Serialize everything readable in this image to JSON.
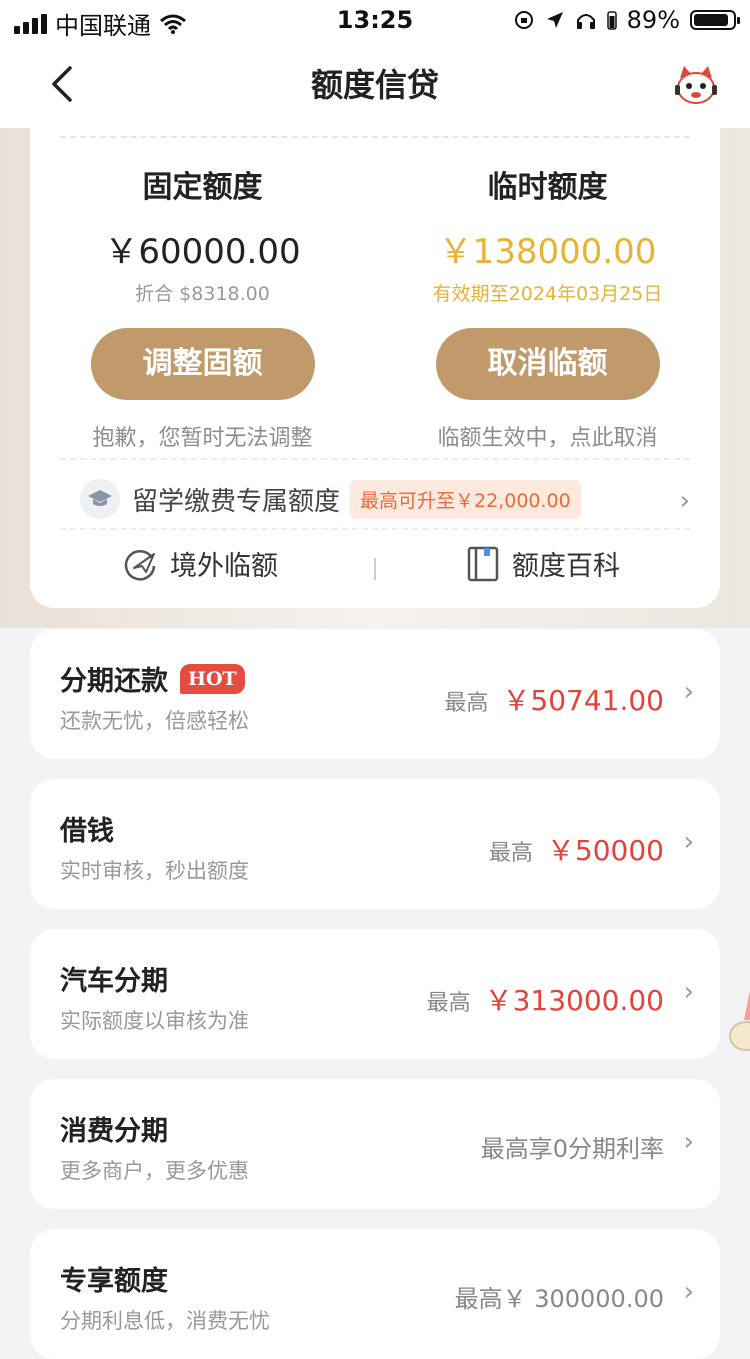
{
  "status_bar": {
    "carrier": "中国联通",
    "time": "13:25",
    "battery_percent": "89%",
    "battery_level": 0.89
  },
  "nav": {
    "title": "额度信贷"
  },
  "quota": {
    "fixed": {
      "title": "固定额度",
      "amount": "￥60000.00",
      "sub": "折合 $8318.00",
      "button": "调整固额",
      "note": "抱歉，您暂时无法调整"
    },
    "temporary": {
      "title": "临时额度",
      "amount": "￥138000.00",
      "sub": "有效期至2024年03月25日",
      "button": "取消临额",
      "note": "临额生效中，点此取消"
    },
    "study": {
      "label": "留学缴费专属额度",
      "badge": "最高可升至￥22,000.00"
    },
    "links": {
      "overseas": "境外临额",
      "wiki": "额度百科"
    }
  },
  "products": [
    {
      "title": "分期还款",
      "hot": "HOT",
      "sub": "还款无忧，倍感轻松",
      "prefix": "最高",
      "amount": "￥50741.00"
    },
    {
      "title": "借钱",
      "sub": "实时审核，秒出额度",
      "prefix": "最高",
      "amount": "￥50000"
    },
    {
      "title": "汽车分期",
      "sub": "实际额度以审核为准",
      "prefix": "最高",
      "amount": "￥313000.00"
    },
    {
      "title": "消费分期",
      "sub": "更多商户，更多优惠",
      "text": "最高享0分期利率"
    },
    {
      "title": "专享额度",
      "sub": "分期利息低，消费无忧",
      "text": "最高￥ 300000.00"
    }
  ],
  "colors": {
    "accent_button": "#c09a6b",
    "gold": "#e8b234",
    "red_amount": "#e3433b",
    "hot_badge": "#e54b3f"
  }
}
